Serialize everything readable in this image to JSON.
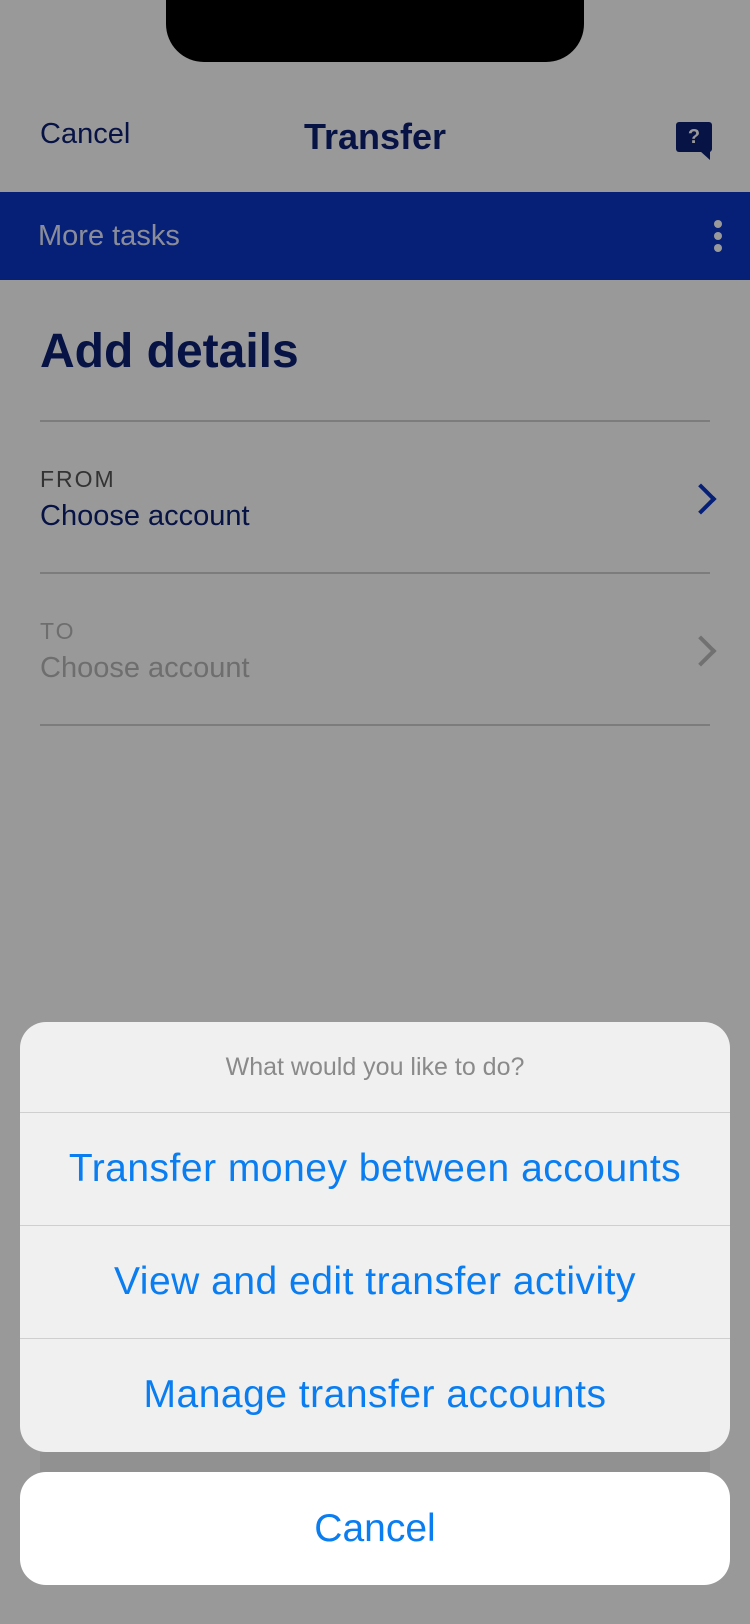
{
  "nav": {
    "cancel": "Cancel",
    "title": "Transfer",
    "help_icon": "?"
  },
  "tasks_bar": {
    "label": "More tasks",
    "menu_icon": "kebab-menu-icon"
  },
  "content": {
    "heading": "Add details",
    "from": {
      "label": "FROM",
      "value": "Choose account"
    },
    "to": {
      "label": "TO",
      "value": "Choose account"
    }
  },
  "action_sheet": {
    "title": "What would you like to do?",
    "actions": [
      "Transfer money between accounts",
      "View and edit transfer activity",
      "Manage transfer accounts"
    ],
    "cancel": "Cancel"
  },
  "colors": {
    "navy": "#0c2074",
    "tasks_bar": "#0b34c6",
    "action_blue": "#0a7df1",
    "sheet_bg": "#f0f0f0",
    "overlay": "#999999"
  }
}
